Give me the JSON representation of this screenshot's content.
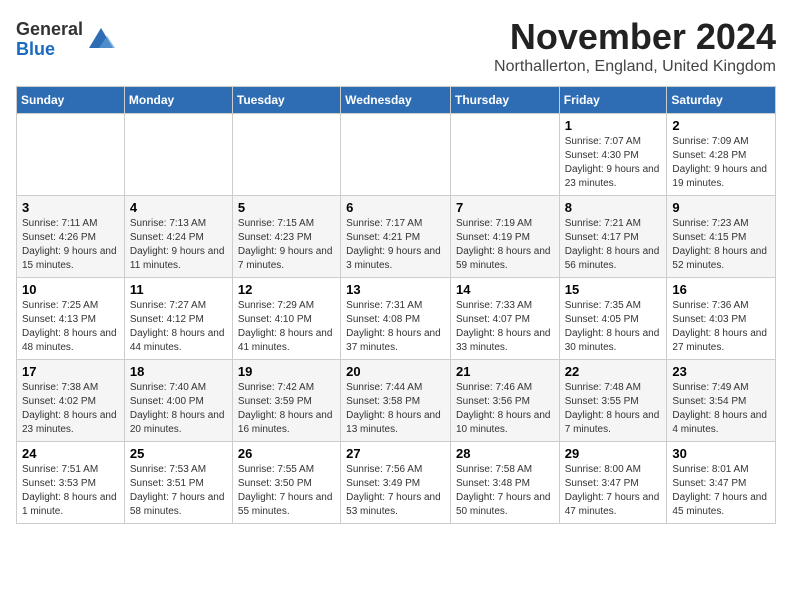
{
  "logo": {
    "general": "General",
    "blue": "Blue"
  },
  "title": "November 2024",
  "subtitle": "Northallerton, England, United Kingdom",
  "weekdays": [
    "Sunday",
    "Monday",
    "Tuesday",
    "Wednesday",
    "Thursday",
    "Friday",
    "Saturday"
  ],
  "weeks": [
    [
      {
        "day": "",
        "info": ""
      },
      {
        "day": "",
        "info": ""
      },
      {
        "day": "",
        "info": ""
      },
      {
        "day": "",
        "info": ""
      },
      {
        "day": "",
        "info": ""
      },
      {
        "day": "1",
        "info": "Sunrise: 7:07 AM\nSunset: 4:30 PM\nDaylight: 9 hours\nand 23 minutes."
      },
      {
        "day": "2",
        "info": "Sunrise: 7:09 AM\nSunset: 4:28 PM\nDaylight: 9 hours\nand 19 minutes."
      }
    ],
    [
      {
        "day": "3",
        "info": "Sunrise: 7:11 AM\nSunset: 4:26 PM\nDaylight: 9 hours\nand 15 minutes."
      },
      {
        "day": "4",
        "info": "Sunrise: 7:13 AM\nSunset: 4:24 PM\nDaylight: 9 hours\nand 11 minutes."
      },
      {
        "day": "5",
        "info": "Sunrise: 7:15 AM\nSunset: 4:23 PM\nDaylight: 9 hours\nand 7 minutes."
      },
      {
        "day": "6",
        "info": "Sunrise: 7:17 AM\nSunset: 4:21 PM\nDaylight: 9 hours\nand 3 minutes."
      },
      {
        "day": "7",
        "info": "Sunrise: 7:19 AM\nSunset: 4:19 PM\nDaylight: 8 hours\nand 59 minutes."
      },
      {
        "day": "8",
        "info": "Sunrise: 7:21 AM\nSunset: 4:17 PM\nDaylight: 8 hours\nand 56 minutes."
      },
      {
        "day": "9",
        "info": "Sunrise: 7:23 AM\nSunset: 4:15 PM\nDaylight: 8 hours\nand 52 minutes."
      }
    ],
    [
      {
        "day": "10",
        "info": "Sunrise: 7:25 AM\nSunset: 4:13 PM\nDaylight: 8 hours\nand 48 minutes."
      },
      {
        "day": "11",
        "info": "Sunrise: 7:27 AM\nSunset: 4:12 PM\nDaylight: 8 hours\nand 44 minutes."
      },
      {
        "day": "12",
        "info": "Sunrise: 7:29 AM\nSunset: 4:10 PM\nDaylight: 8 hours\nand 41 minutes."
      },
      {
        "day": "13",
        "info": "Sunrise: 7:31 AM\nSunset: 4:08 PM\nDaylight: 8 hours\nand 37 minutes."
      },
      {
        "day": "14",
        "info": "Sunrise: 7:33 AM\nSunset: 4:07 PM\nDaylight: 8 hours\nand 33 minutes."
      },
      {
        "day": "15",
        "info": "Sunrise: 7:35 AM\nSunset: 4:05 PM\nDaylight: 8 hours\nand 30 minutes."
      },
      {
        "day": "16",
        "info": "Sunrise: 7:36 AM\nSunset: 4:03 PM\nDaylight: 8 hours\nand 27 minutes."
      }
    ],
    [
      {
        "day": "17",
        "info": "Sunrise: 7:38 AM\nSunset: 4:02 PM\nDaylight: 8 hours\nand 23 minutes."
      },
      {
        "day": "18",
        "info": "Sunrise: 7:40 AM\nSunset: 4:00 PM\nDaylight: 8 hours\nand 20 minutes."
      },
      {
        "day": "19",
        "info": "Sunrise: 7:42 AM\nSunset: 3:59 PM\nDaylight: 8 hours\nand 16 minutes."
      },
      {
        "day": "20",
        "info": "Sunrise: 7:44 AM\nSunset: 3:58 PM\nDaylight: 8 hours\nand 13 minutes."
      },
      {
        "day": "21",
        "info": "Sunrise: 7:46 AM\nSunset: 3:56 PM\nDaylight: 8 hours\nand 10 minutes."
      },
      {
        "day": "22",
        "info": "Sunrise: 7:48 AM\nSunset: 3:55 PM\nDaylight: 8 hours\nand 7 minutes."
      },
      {
        "day": "23",
        "info": "Sunrise: 7:49 AM\nSunset: 3:54 PM\nDaylight: 8 hours\nand 4 minutes."
      }
    ],
    [
      {
        "day": "24",
        "info": "Sunrise: 7:51 AM\nSunset: 3:53 PM\nDaylight: 8 hours\nand 1 minute."
      },
      {
        "day": "25",
        "info": "Sunrise: 7:53 AM\nSunset: 3:51 PM\nDaylight: 7 hours\nand 58 minutes."
      },
      {
        "day": "26",
        "info": "Sunrise: 7:55 AM\nSunset: 3:50 PM\nDaylight: 7 hours\nand 55 minutes."
      },
      {
        "day": "27",
        "info": "Sunrise: 7:56 AM\nSunset: 3:49 PM\nDaylight: 7 hours\nand 53 minutes."
      },
      {
        "day": "28",
        "info": "Sunrise: 7:58 AM\nSunset: 3:48 PM\nDaylight: 7 hours\nand 50 minutes."
      },
      {
        "day": "29",
        "info": "Sunrise: 8:00 AM\nSunset: 3:47 PM\nDaylight: 7 hours\nand 47 minutes."
      },
      {
        "day": "30",
        "info": "Sunrise: 8:01 AM\nSunset: 3:47 PM\nDaylight: 7 hours\nand 45 minutes."
      }
    ]
  ]
}
